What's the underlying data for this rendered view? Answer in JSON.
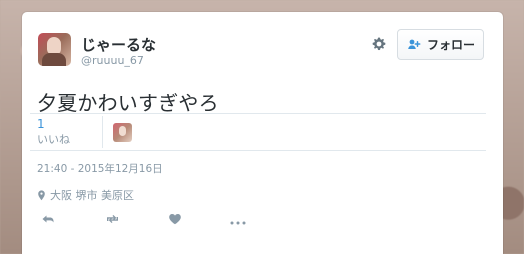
{
  "profile": {
    "display_name": "じゃーるな",
    "screen_name": "@ruuuu_67"
  },
  "header": {
    "follow_label": "フォロー"
  },
  "tweet": {
    "text": "夕夏かわいすぎやろ",
    "like_count": "1",
    "like_label": "いいね",
    "timestamp": "21:40 - 2015年12月16日",
    "location": "大阪 堺市 美原区"
  },
  "icons": {
    "settings": "gear-icon",
    "follow": "follow-user-icon",
    "location": "location-pin-icon",
    "reply": "reply-icon",
    "retweet": "retweet-icon",
    "like": "heart-icon",
    "more": "more-icon"
  },
  "colors": {
    "accent": "#3b94d9",
    "text": "#292f33",
    "muted": "#8899a6",
    "border": "#e1e8ed"
  }
}
